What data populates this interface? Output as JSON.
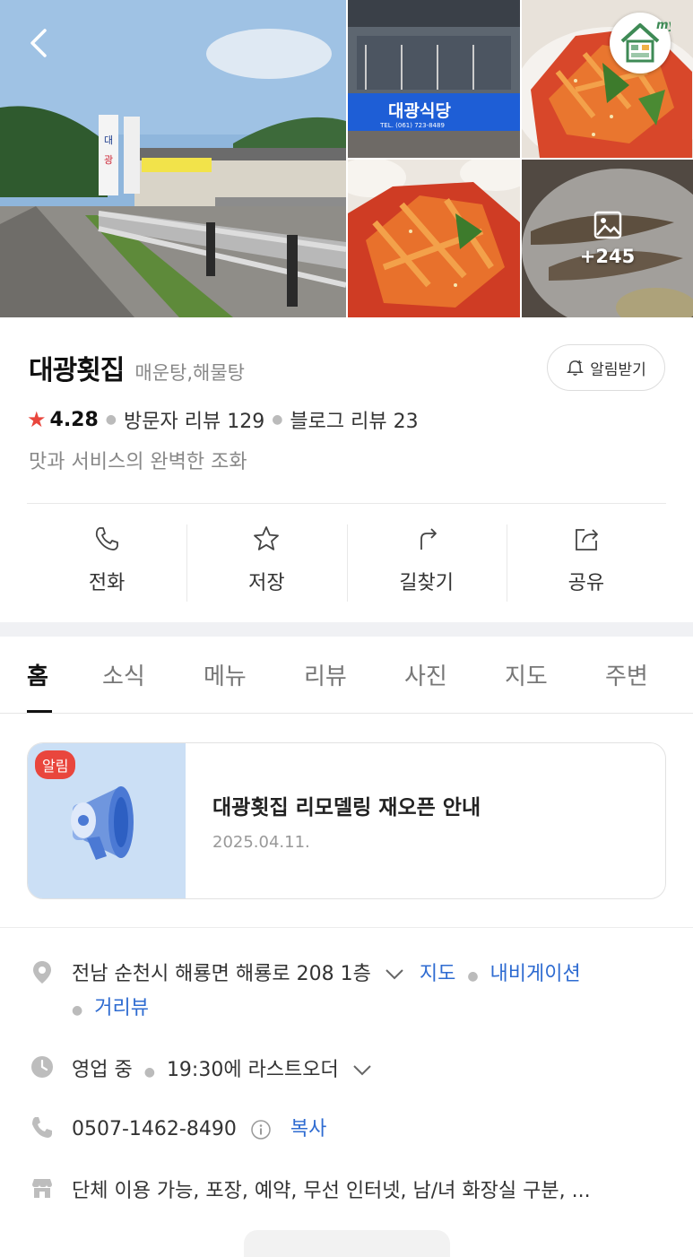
{
  "gallery": {
    "sign_text": "대광식당",
    "sign_phone": "TEL. (061) 723-8489",
    "roadside_sign": "대광횟집",
    "more_photos_count": "+245"
  },
  "place": {
    "name": "대광횟집",
    "category": "매운탕,해물탕",
    "alarm_label": "알림받기",
    "rating": "4.28",
    "visitor_reviews": "방문자 리뷰 129",
    "blog_reviews": "블로그 리뷰 23",
    "tagline": "맛과 서비스의 완벽한 조화"
  },
  "actions": [
    {
      "label": "전화",
      "icon": "phone-icon"
    },
    {
      "label": "저장",
      "icon": "star-icon"
    },
    {
      "label": "길찾기",
      "icon": "directions-icon"
    },
    {
      "label": "공유",
      "icon": "share-icon"
    }
  ],
  "tabs": [
    {
      "label": "홈",
      "active": true
    },
    {
      "label": "소식"
    },
    {
      "label": "메뉴"
    },
    {
      "label": "리뷰"
    },
    {
      "label": "사진"
    },
    {
      "label": "지도"
    },
    {
      "label": "주변"
    }
  ],
  "notice": {
    "badge": "알림",
    "title": "대광횟집 리모델링 재오픈 안내",
    "date": "2025.04.11."
  },
  "info": {
    "address": "전남 순천시 해룡면 해룡로 208 1층",
    "map_link": "지도",
    "navi_link": "내비게이션",
    "streetview_link": "거리뷰",
    "hours_status": "영업 중",
    "last_order": "19:30에 라스트오더",
    "phone": "0507-1462-8490",
    "copy_label": "복사",
    "amenities": "단체 이용 가능, 포장, 예약, 무선 인터넷, 남/녀 화장실 구분, ..."
  },
  "colors": {
    "accent_link": "#2e6bd1",
    "star": "#e9463d",
    "badge": "#e9463d"
  }
}
